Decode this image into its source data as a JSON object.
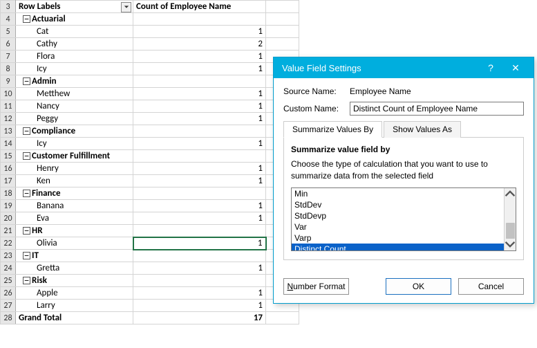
{
  "pivot": {
    "headers": {
      "rowLabels": "Row Labels",
      "count": "Count of Employee Name"
    },
    "rows": [
      {
        "n": 3,
        "type": "header"
      },
      {
        "n": 4,
        "type": "group",
        "label": "Actuarial"
      },
      {
        "n": 5,
        "type": "item",
        "label": "Cat",
        "val": "1"
      },
      {
        "n": 6,
        "type": "item",
        "label": "Cathy",
        "val": "2"
      },
      {
        "n": 7,
        "type": "item",
        "label": "Flora",
        "val": "1"
      },
      {
        "n": 8,
        "type": "item",
        "label": "Icy",
        "val": "1"
      },
      {
        "n": 9,
        "type": "group",
        "label": "Admin"
      },
      {
        "n": 10,
        "type": "item",
        "label": "Metthew",
        "val": "1"
      },
      {
        "n": 11,
        "type": "item",
        "label": "Nancy",
        "val": "1"
      },
      {
        "n": 12,
        "type": "item",
        "label": "Peggy",
        "val": "1"
      },
      {
        "n": 13,
        "type": "group",
        "label": "Compliance"
      },
      {
        "n": 14,
        "type": "item",
        "label": "Icy",
        "val": "1"
      },
      {
        "n": 15,
        "type": "group",
        "label": "Customer Fulfillment"
      },
      {
        "n": 16,
        "type": "item",
        "label": "Henry",
        "val": "1"
      },
      {
        "n": 17,
        "type": "item",
        "label": "Ken",
        "val": "1"
      },
      {
        "n": 18,
        "type": "group",
        "label": "Finance"
      },
      {
        "n": 19,
        "type": "item",
        "label": "Banana",
        "val": "1"
      },
      {
        "n": 20,
        "type": "item",
        "label": "Eva",
        "val": "1"
      },
      {
        "n": 21,
        "type": "group",
        "label": "HR"
      },
      {
        "n": 22,
        "type": "item",
        "label": "Olivia",
        "val": "1",
        "active": true
      },
      {
        "n": 23,
        "type": "group",
        "label": "IT"
      },
      {
        "n": 24,
        "type": "item",
        "label": "Gretta",
        "val": "1"
      },
      {
        "n": 25,
        "type": "group",
        "label": "Risk"
      },
      {
        "n": 26,
        "type": "item",
        "label": "Apple",
        "val": "1"
      },
      {
        "n": 27,
        "type": "item",
        "label": "Larry",
        "val": "1"
      },
      {
        "n": 28,
        "type": "total",
        "label": "Grand Total",
        "val": "17"
      }
    ]
  },
  "dialog": {
    "title": "Value Field Settings",
    "help": "?",
    "close": "✕",
    "sourceLabel": "Source Name:",
    "sourceValue": "Employee Name",
    "customLabel": "Custom Name:",
    "customValue": "Distinct Count of Employee Name",
    "tabs": {
      "summarize": "Summarize Values By",
      "show": "Show Values As"
    },
    "panelHead": "Summarize value field by",
    "panelDesc": "Choose the type of calculation that you want to use to summarize data from the selected field",
    "options": [
      "Min",
      "StdDev",
      "StdDevp",
      "Var",
      "Varp",
      "Distinct Count"
    ],
    "selectedIndex": 5,
    "numberFormat": "Number Format",
    "ok": "OK",
    "cancel": "Cancel"
  }
}
